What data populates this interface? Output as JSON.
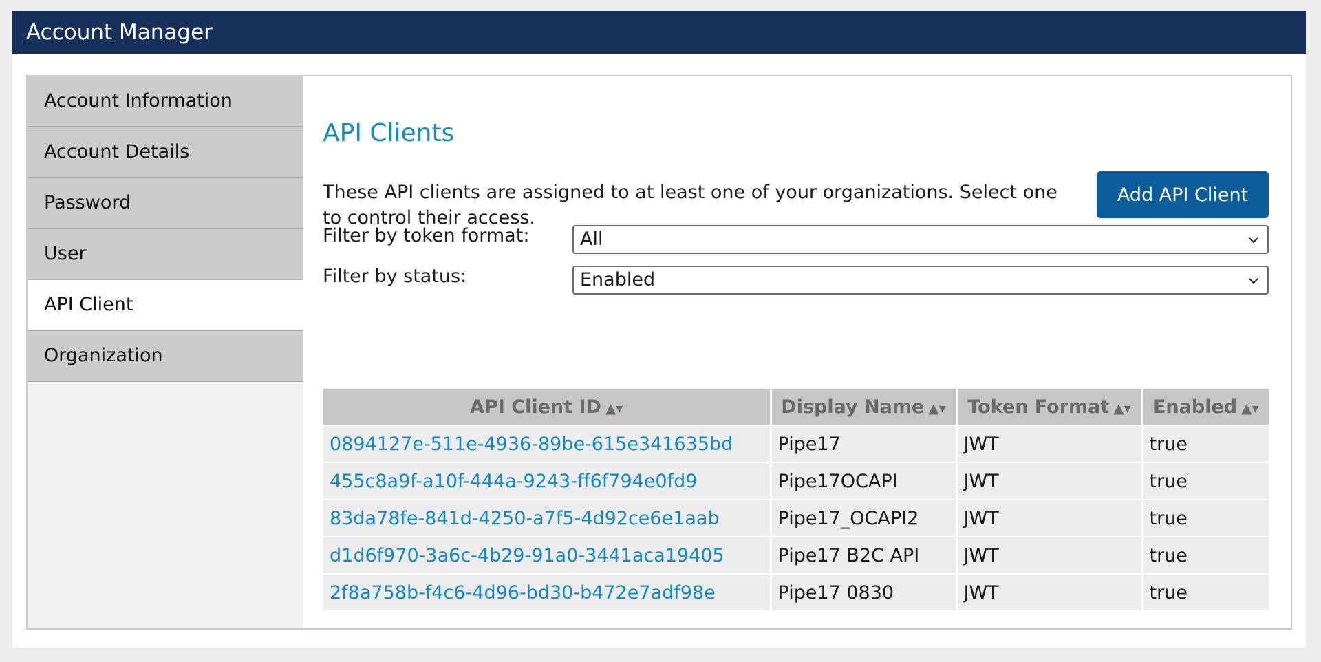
{
  "app": {
    "title": "Account Manager"
  },
  "sidebar": {
    "items": [
      {
        "label": "Account Information",
        "active": false
      },
      {
        "label": "Account Details",
        "active": false
      },
      {
        "label": "Password",
        "active": false
      },
      {
        "label": "User",
        "active": false
      },
      {
        "label": "API Client",
        "active": true
      },
      {
        "label": "Organization",
        "active": false
      }
    ]
  },
  "main": {
    "title": "API Clients",
    "description": "These API clients are assigned to at least one of your organizations. Select one to control their access.",
    "add_button_label": "Add API Client",
    "filters": {
      "token_format": {
        "label": "Filter by token format:",
        "value": "All"
      },
      "status": {
        "label": "Filter by status:",
        "value": "Enabled"
      }
    }
  },
  "table": {
    "sort_indicator": "▲▾",
    "columns": [
      "API Client ID",
      "Display Name",
      "Token Format",
      "Enabled"
    ],
    "rows": [
      [
        "0894127e-511e-4936-89be-615e341635bd",
        "Pipe17",
        "JWT",
        "true"
      ],
      [
        "455c8a9f-a10f-444a-9243-ff6f794e0fd9",
        "Pipe17OCAPI",
        "JWT",
        "true"
      ],
      [
        "83da78fe-841d-4250-a7f5-4d92ce6e1aab",
        "Pipe17_OCAPI2",
        "JWT",
        "true"
      ],
      [
        "d1d6f970-3a6c-4b29-91a0-3441aca19405",
        "Pipe17 B2C API",
        "JWT",
        "true"
      ],
      [
        "2f8a758b-f4c6-4d96-bd30-b472e7adf98e",
        "Pipe17 0830",
        "JWT",
        "true"
      ]
    ]
  },
  "colors": {
    "header_bg": "#16325c",
    "accent_link": "#1589c2",
    "button_bg": "#0b5e99"
  }
}
